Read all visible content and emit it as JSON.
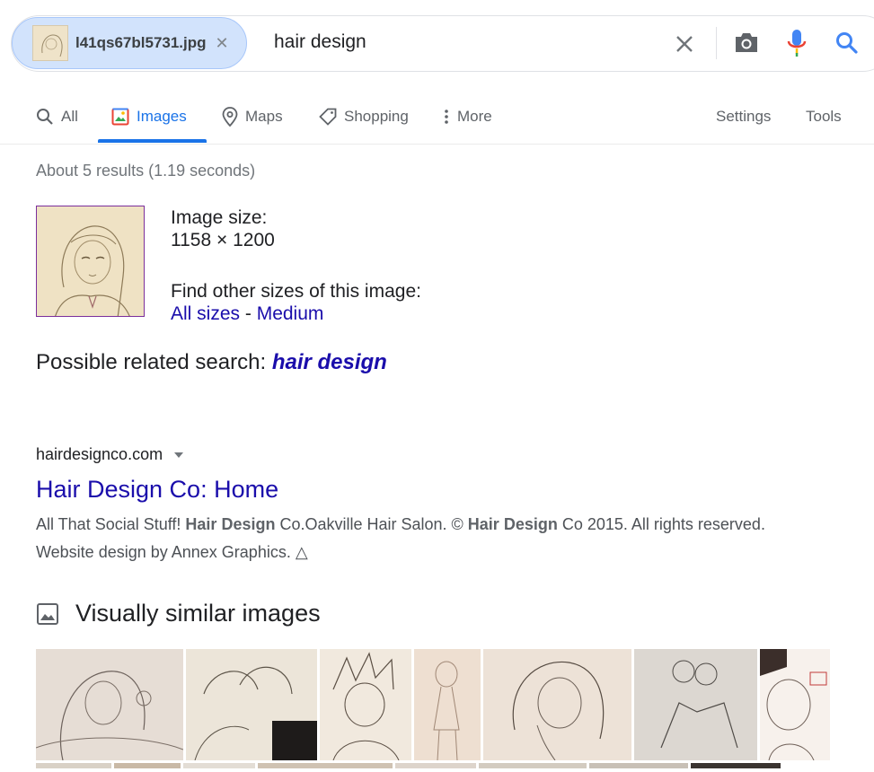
{
  "search": {
    "chip_filename": "l41qs67bl5731.jpg",
    "query": "hair design"
  },
  "tabs": [
    {
      "label": "All",
      "icon": "search-icon",
      "active": false
    },
    {
      "label": "Images",
      "icon": "image-icon",
      "active": true
    },
    {
      "label": "Maps",
      "icon": "map-pin-icon",
      "active": false
    },
    {
      "label": "Shopping",
      "icon": "tag-icon",
      "active": false
    },
    {
      "label": "More",
      "icon": "more-vert-icon",
      "active": false
    }
  ],
  "tools": {
    "settings": "Settings",
    "tools": "Tools"
  },
  "stats": "About 5 results (1.19 seconds)",
  "image_info": {
    "size_label": "Image size:",
    "size_value": "1158 × 1200",
    "other_sizes_label": "Find other sizes of this image:",
    "all_sizes": "All sizes",
    "separator": " - ",
    "medium": "Medium"
  },
  "related": {
    "prefix": "Possible related search: ",
    "term": "hair design"
  },
  "result": {
    "cite": "hairdesignco.com",
    "title": "Hair Design Co: Home",
    "snippet_parts": [
      "All That Social Stuff! ",
      "Hair Design",
      " Co.Oakville Hair Salon. © ",
      "Hair Design",
      " Co 2015. All rights reserved. Website design by Annex Graphics. "
    ],
    "snippet_end_glyph": "△"
  },
  "visually_similar": {
    "heading": "Visually similar images"
  },
  "colors": {
    "accent": "#1a73e8",
    "link": "#1a0dab",
    "chip_bg": "#d2e3fc"
  }
}
